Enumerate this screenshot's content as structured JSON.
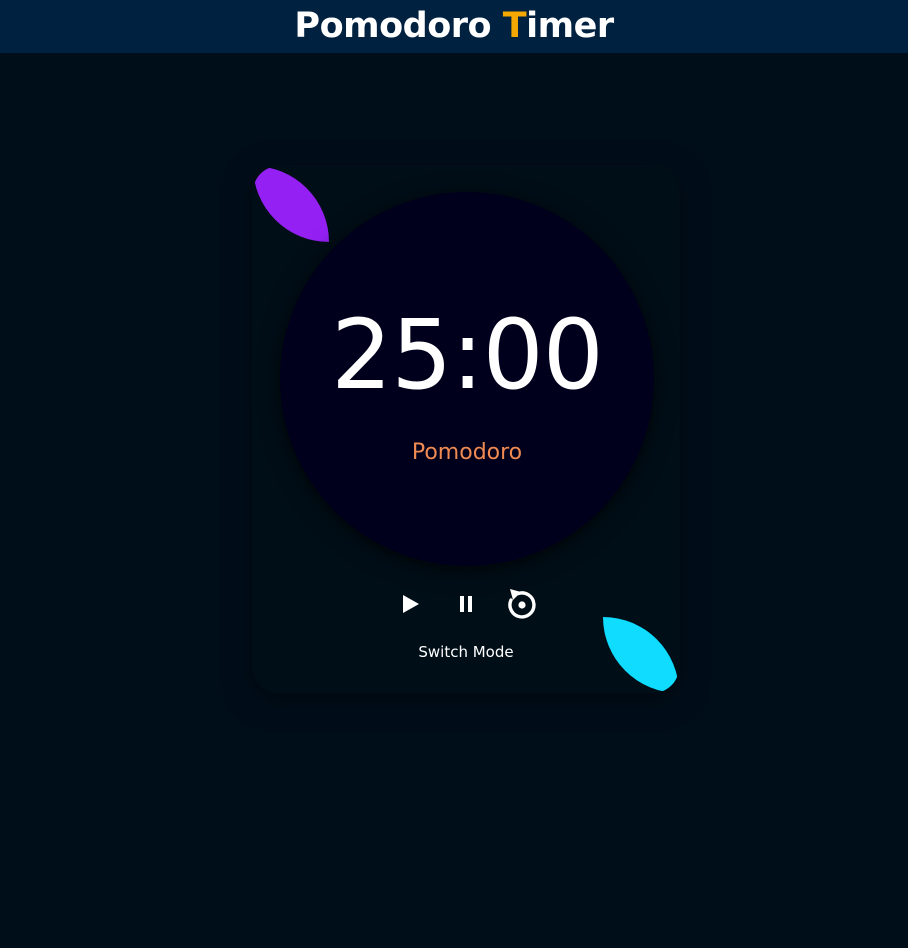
{
  "header": {
    "title_part1": "Pomodoro ",
    "title_accent": "T",
    "title_part2": "imer",
    "accent_color": "#f5a800"
  },
  "timer": {
    "display": "25:00",
    "mode": "Pomodoro",
    "mode_color": "#ef8a52"
  },
  "controls": {
    "icons": [
      "play-icon",
      "pause-icon",
      "reset-icon"
    ]
  },
  "switch_mode_label": "Switch Mode",
  "decor": {
    "purple": "#9520f4",
    "cyan": "#0fdcff"
  }
}
